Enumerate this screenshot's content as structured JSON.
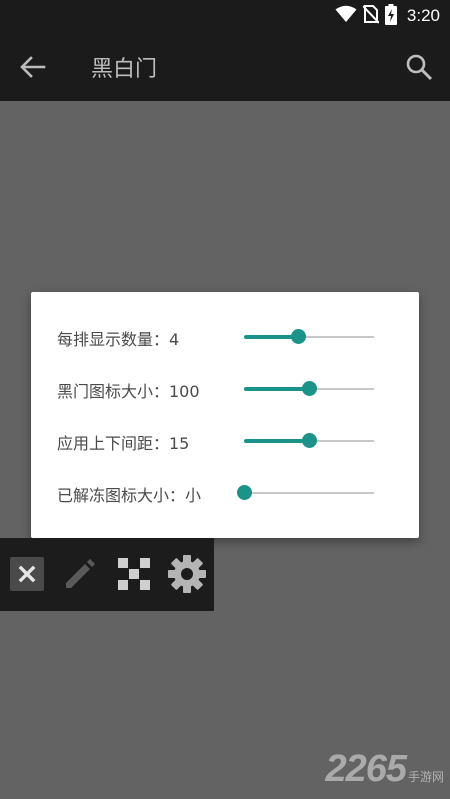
{
  "status_bar": {
    "time": "3:20",
    "icons": [
      "wifi-icon",
      "no-sim-icon",
      "battery-charging-icon"
    ]
  },
  "app_bar": {
    "title": "黑白门",
    "back_icon": "arrow-back-icon",
    "search_icon": "search-icon"
  },
  "settings_dialog": {
    "accent_color": "#1a9488",
    "rows": [
      {
        "label": "每排显示数量：4",
        "level": 0.42
      },
      {
        "label": "黑门图标大小：100",
        "level": 0.5
      },
      {
        "label": "应用上下间距：15",
        "level": 0.5
      },
      {
        "label": "已解冻图标大小：小",
        "level": 0.0
      }
    ]
  },
  "toolbar": {
    "icons": [
      "close-icon",
      "pencil-icon",
      "checkerboard-icon",
      "gear-icon"
    ]
  },
  "watermark": {
    "brand": "2265",
    "sub": "手游网"
  }
}
